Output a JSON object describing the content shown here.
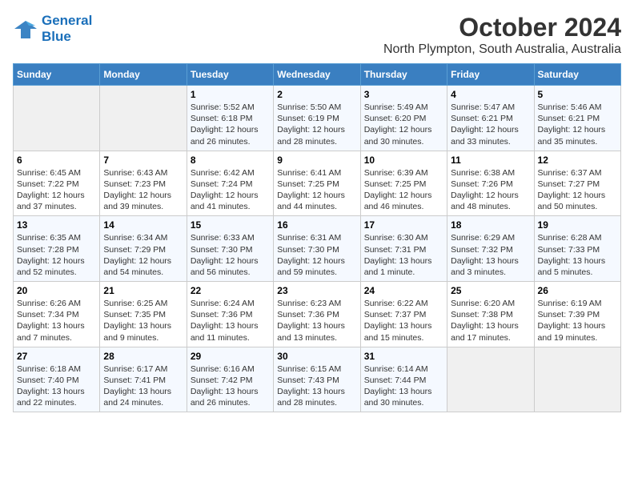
{
  "logo": {
    "line1": "General",
    "line2": "Blue"
  },
  "title": "October 2024",
  "subtitle": "North Plympton, South Australia, Australia",
  "days_of_week": [
    "Sunday",
    "Monday",
    "Tuesday",
    "Wednesday",
    "Thursday",
    "Friday",
    "Saturday"
  ],
  "weeks": [
    [
      {
        "day": "",
        "info": ""
      },
      {
        "day": "",
        "info": ""
      },
      {
        "day": "1",
        "info": "Sunrise: 5:52 AM\nSunset: 6:18 PM\nDaylight: 12 hours\nand 26 minutes."
      },
      {
        "day": "2",
        "info": "Sunrise: 5:50 AM\nSunset: 6:19 PM\nDaylight: 12 hours\nand 28 minutes."
      },
      {
        "day": "3",
        "info": "Sunrise: 5:49 AM\nSunset: 6:20 PM\nDaylight: 12 hours\nand 30 minutes."
      },
      {
        "day": "4",
        "info": "Sunrise: 5:47 AM\nSunset: 6:21 PM\nDaylight: 12 hours\nand 33 minutes."
      },
      {
        "day": "5",
        "info": "Sunrise: 5:46 AM\nSunset: 6:21 PM\nDaylight: 12 hours\nand 35 minutes."
      }
    ],
    [
      {
        "day": "6",
        "info": "Sunrise: 6:45 AM\nSunset: 7:22 PM\nDaylight: 12 hours\nand 37 minutes."
      },
      {
        "day": "7",
        "info": "Sunrise: 6:43 AM\nSunset: 7:23 PM\nDaylight: 12 hours\nand 39 minutes."
      },
      {
        "day": "8",
        "info": "Sunrise: 6:42 AM\nSunset: 7:24 PM\nDaylight: 12 hours\nand 41 minutes."
      },
      {
        "day": "9",
        "info": "Sunrise: 6:41 AM\nSunset: 7:25 PM\nDaylight: 12 hours\nand 44 minutes."
      },
      {
        "day": "10",
        "info": "Sunrise: 6:39 AM\nSunset: 7:25 PM\nDaylight: 12 hours\nand 46 minutes."
      },
      {
        "day": "11",
        "info": "Sunrise: 6:38 AM\nSunset: 7:26 PM\nDaylight: 12 hours\nand 48 minutes."
      },
      {
        "day": "12",
        "info": "Sunrise: 6:37 AM\nSunset: 7:27 PM\nDaylight: 12 hours\nand 50 minutes."
      }
    ],
    [
      {
        "day": "13",
        "info": "Sunrise: 6:35 AM\nSunset: 7:28 PM\nDaylight: 12 hours\nand 52 minutes."
      },
      {
        "day": "14",
        "info": "Sunrise: 6:34 AM\nSunset: 7:29 PM\nDaylight: 12 hours\nand 54 minutes."
      },
      {
        "day": "15",
        "info": "Sunrise: 6:33 AM\nSunset: 7:30 PM\nDaylight: 12 hours\nand 56 minutes."
      },
      {
        "day": "16",
        "info": "Sunrise: 6:31 AM\nSunset: 7:30 PM\nDaylight: 12 hours\nand 59 minutes."
      },
      {
        "day": "17",
        "info": "Sunrise: 6:30 AM\nSunset: 7:31 PM\nDaylight: 13 hours\nand 1 minute."
      },
      {
        "day": "18",
        "info": "Sunrise: 6:29 AM\nSunset: 7:32 PM\nDaylight: 13 hours\nand 3 minutes."
      },
      {
        "day": "19",
        "info": "Sunrise: 6:28 AM\nSunset: 7:33 PM\nDaylight: 13 hours\nand 5 minutes."
      }
    ],
    [
      {
        "day": "20",
        "info": "Sunrise: 6:26 AM\nSunset: 7:34 PM\nDaylight: 13 hours\nand 7 minutes."
      },
      {
        "day": "21",
        "info": "Sunrise: 6:25 AM\nSunset: 7:35 PM\nDaylight: 13 hours\nand 9 minutes."
      },
      {
        "day": "22",
        "info": "Sunrise: 6:24 AM\nSunset: 7:36 PM\nDaylight: 13 hours\nand 11 minutes."
      },
      {
        "day": "23",
        "info": "Sunrise: 6:23 AM\nSunset: 7:36 PM\nDaylight: 13 hours\nand 13 minutes."
      },
      {
        "day": "24",
        "info": "Sunrise: 6:22 AM\nSunset: 7:37 PM\nDaylight: 13 hours\nand 15 minutes."
      },
      {
        "day": "25",
        "info": "Sunrise: 6:20 AM\nSunset: 7:38 PM\nDaylight: 13 hours\nand 17 minutes."
      },
      {
        "day": "26",
        "info": "Sunrise: 6:19 AM\nSunset: 7:39 PM\nDaylight: 13 hours\nand 19 minutes."
      }
    ],
    [
      {
        "day": "27",
        "info": "Sunrise: 6:18 AM\nSunset: 7:40 PM\nDaylight: 13 hours\nand 22 minutes."
      },
      {
        "day": "28",
        "info": "Sunrise: 6:17 AM\nSunset: 7:41 PM\nDaylight: 13 hours\nand 24 minutes."
      },
      {
        "day": "29",
        "info": "Sunrise: 6:16 AM\nSunset: 7:42 PM\nDaylight: 13 hours\nand 26 minutes."
      },
      {
        "day": "30",
        "info": "Sunrise: 6:15 AM\nSunset: 7:43 PM\nDaylight: 13 hours\nand 28 minutes."
      },
      {
        "day": "31",
        "info": "Sunrise: 6:14 AM\nSunset: 7:44 PM\nDaylight: 13 hours\nand 30 minutes."
      },
      {
        "day": "",
        "info": ""
      },
      {
        "day": "",
        "info": ""
      }
    ]
  ]
}
